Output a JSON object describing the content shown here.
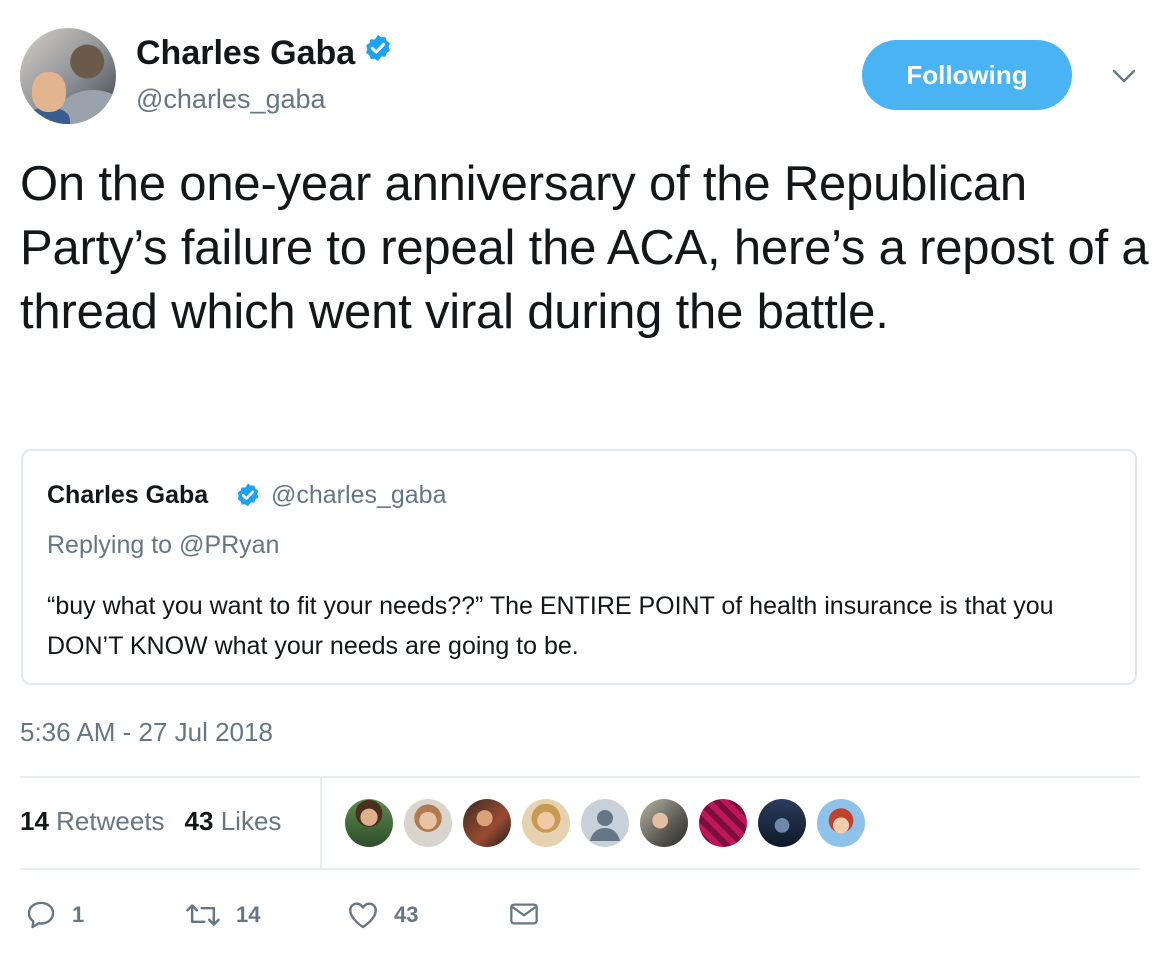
{
  "author": {
    "name": "Charles Gaba",
    "handle": "@charles_gaba",
    "verified": true
  },
  "follow_button": {
    "label": "Following",
    "color": "#4ab3f4"
  },
  "tweet": {
    "text": "On the one-year anniversary of the Republican Party’s failure to repeal the ACA, here’s a repost of a thread which went viral during the battle.",
    "timestamp": "5:36 AM - 27 Jul 2018"
  },
  "quoted_tweet": {
    "name": "Charles Gaba",
    "handle": "@charles_gaba",
    "reply_to": "Replying to @PRyan",
    "text": "“buy what you want to fit your needs??” The ENTIRE POINT of health insurance is that you DON’T KNOW what your needs are going to be."
  },
  "stats": {
    "retweets_count": "14",
    "retweets_label": "Retweets",
    "likes_count": "43",
    "likes_label": "Likes"
  },
  "likers": [
    {
      "icon": "liker-avatar-1",
      "color": "#3b6b3a"
    },
    {
      "icon": "liker-avatar-2",
      "color": "#c8a98a"
    },
    {
      "icon": "liker-avatar-3",
      "color": "#7a3b2a"
    },
    {
      "icon": "liker-avatar-4",
      "color": "#d8b27a"
    },
    {
      "icon": "default-avatar-icon",
      "color": "#b8c2cc"
    },
    {
      "icon": "liker-avatar-6",
      "color": "#8a8a80"
    },
    {
      "icon": "liker-avatar-7",
      "color": "#b8185a"
    },
    {
      "icon": "liker-avatar-8",
      "color": "#1f2e48"
    },
    {
      "icon": "liker-avatar-9",
      "color": "#6aa6d6"
    }
  ],
  "actions": {
    "reply_count": "1",
    "retweet_count": "14",
    "like_count": "43"
  },
  "colors": {
    "text": "#14171a",
    "secondary": "#657786",
    "verified": "#1da1f2",
    "border": "#e1e8ed"
  }
}
